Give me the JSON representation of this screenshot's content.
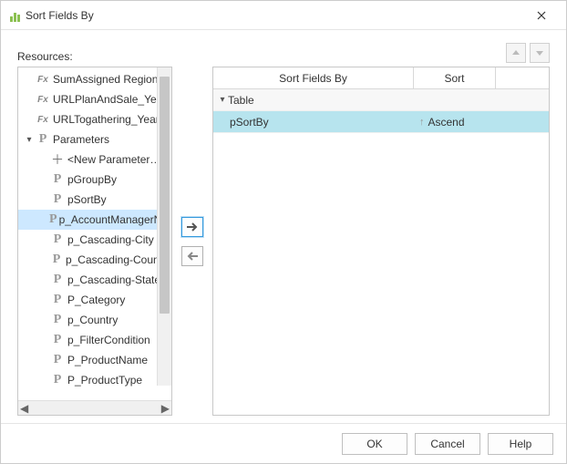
{
  "window": {
    "title": "Sort Fields By"
  },
  "labels": {
    "resources": "Resources:"
  },
  "tree": {
    "items": [
      {
        "icon": "fx",
        "label": "SumAssigned Region",
        "indent": 1
      },
      {
        "icon": "fx",
        "label": "URLPlanAndSale_Year",
        "indent": 1
      },
      {
        "icon": "fx",
        "label": "URLTogathering_Year",
        "indent": 1
      },
      {
        "icon": "p",
        "label": "Parameters",
        "indent": 0,
        "disclose": "open"
      },
      {
        "icon": "plus",
        "label": "<New Parameter…>",
        "indent": 2
      },
      {
        "icon": "p",
        "label": "pGroupBy",
        "indent": 2
      },
      {
        "icon": "p",
        "label": "pSortBy",
        "indent": 2
      },
      {
        "icon": "p",
        "label": "p_AccountManagerName",
        "indent": 2,
        "selected": true
      },
      {
        "icon": "p",
        "label": "p_Cascading-City",
        "indent": 2
      },
      {
        "icon": "p",
        "label": "p_Cascading-Country",
        "indent": 2
      },
      {
        "icon": "p",
        "label": "p_Cascading-State",
        "indent": 2
      },
      {
        "icon": "p",
        "label": "P_Category",
        "indent": 2
      },
      {
        "icon": "p",
        "label": "p_Country",
        "indent": 2
      },
      {
        "icon": "p",
        "label": "p_FilterCondition",
        "indent": 2
      },
      {
        "icon": "p",
        "label": "P_ProductName",
        "indent": 2
      },
      {
        "icon": "p",
        "label": "P_ProductType",
        "indent": 2
      }
    ]
  },
  "table": {
    "headers": {
      "col1": "Sort Fields By",
      "col2": "Sort"
    },
    "group_label": "Table",
    "rows": [
      {
        "field": "pSortBy",
        "sort": "Ascend",
        "selected": true
      }
    ]
  },
  "buttons": {
    "ok": "OK",
    "cancel": "Cancel",
    "help": "Help"
  }
}
